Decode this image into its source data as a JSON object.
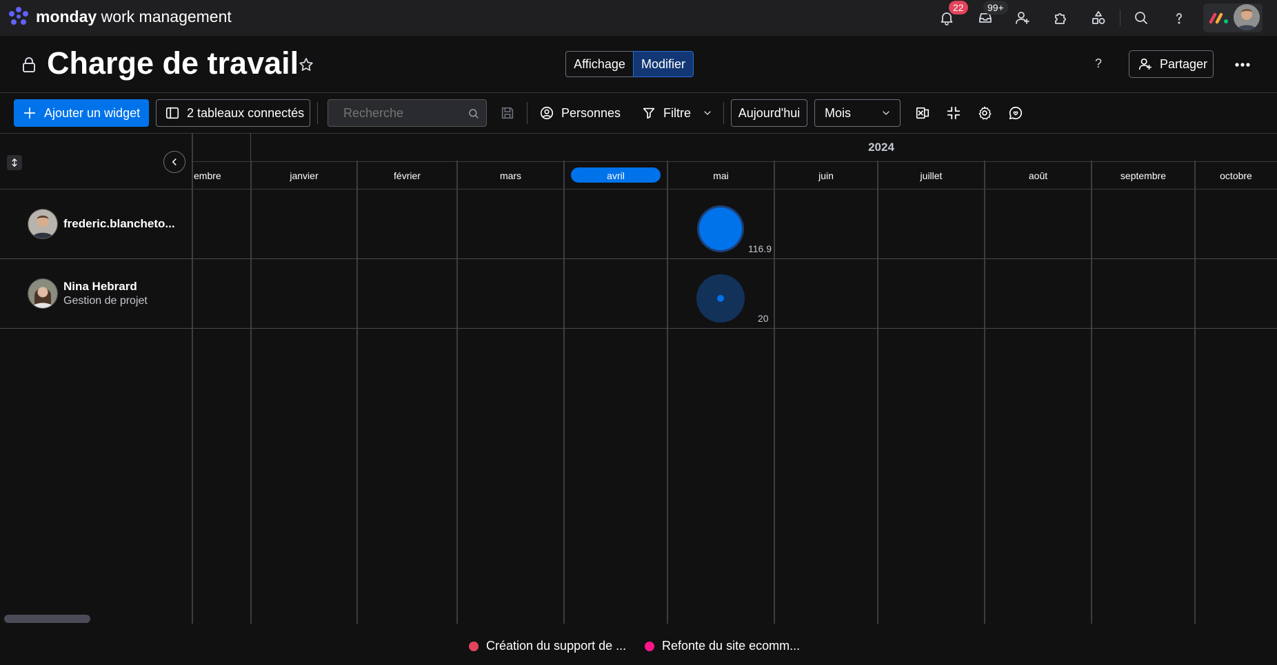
{
  "app": {
    "brand_bold": "monday",
    "brand_light": "work management",
    "notifications_badge": "22",
    "inbox_badge": "99+"
  },
  "board": {
    "title": "Charge de travail",
    "view_toggle": {
      "display_label": "Affichage",
      "edit_label": "Modifier"
    },
    "help": "?",
    "share_label": "Partager"
  },
  "toolbar": {
    "add_widget": "Ajouter un widget",
    "connected_boards": "2 tableaux connectés",
    "search_placeholder": "Recherche",
    "people": "Personnes",
    "filter": "Filtre",
    "today": "Aujourd'hui",
    "period": "Mois"
  },
  "timeline": {
    "year": "2024",
    "months": [
      "embre",
      "janvier",
      "février",
      "mars",
      "avril",
      "mai",
      "juin",
      "juillet",
      "août",
      "septembre",
      "octobre"
    ],
    "current_month": "avril"
  },
  "people": [
    {
      "name": "frederic.blancheto...",
      "role": "",
      "month": "mai",
      "value": "116.9"
    },
    {
      "name": "Nina Hebrard",
      "role": "Gestion de projet",
      "month": "mai",
      "value": "20"
    }
  ],
  "legend": [
    {
      "label": "Création du support de ...",
      "color": "#e2445c"
    },
    {
      "label": "Refonte du site ecomm...",
      "color": "#ff158a"
    }
  ],
  "colors": {
    "accent": "#0073ea",
    "bubble_dark": "#13325a",
    "badge_red": "#e2445c"
  }
}
